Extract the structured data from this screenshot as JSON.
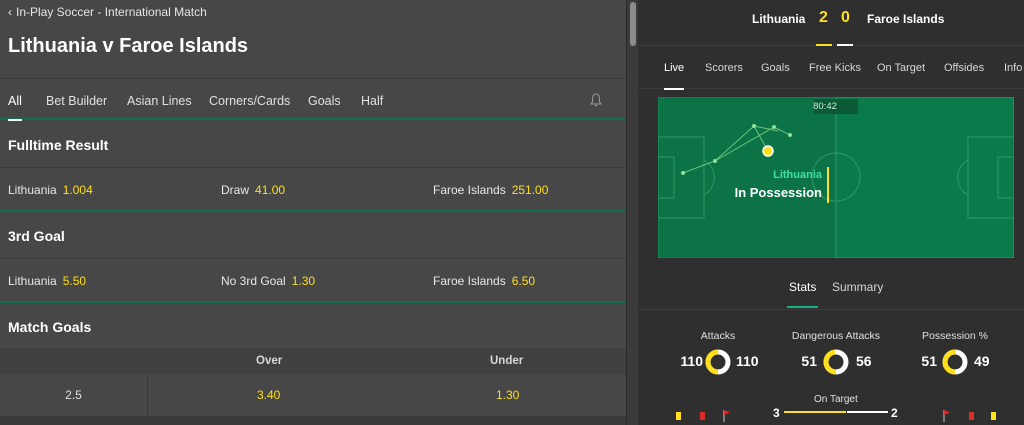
{
  "breadcrumb": "In-Play Soccer - International Match",
  "match_title": "Lithuania v Faroe Islands",
  "tabs": [
    "All",
    "Bet Builder",
    "Asian Lines",
    "Corners/Cards",
    "Goals",
    "Half"
  ],
  "markets": {
    "fulltime": {
      "title": "Fulltime Result",
      "selections": [
        {
          "name": "Lithuania",
          "odds": "1.004"
        },
        {
          "name": "Draw",
          "odds": "41.00"
        },
        {
          "name": "Faroe Islands",
          "odds": "251.00"
        }
      ]
    },
    "third_goal": {
      "title": "3rd Goal",
      "selections": [
        {
          "name": "Lithuania",
          "odds": "5.50"
        },
        {
          "name": "No 3rd Goal",
          "odds": "1.30"
        },
        {
          "name": "Faroe Islands",
          "odds": "6.50"
        }
      ]
    },
    "match_goals": {
      "title": "Match Goals",
      "col_over": "Over",
      "col_under": "Under",
      "line": "2.5",
      "over": "3.40",
      "under": "1.30"
    }
  },
  "scoreboard": {
    "home": "Lithuania",
    "away": "Faroe Islands",
    "home_score": "2",
    "away_score": "0"
  },
  "live_tabs": [
    "Live",
    "Scorers",
    "Goals",
    "Free Kicks",
    "On Target",
    "Offsides",
    "Info"
  ],
  "pitch": {
    "clock": "80:42",
    "team": "Lithuania",
    "status": "In Possession"
  },
  "stats_tabs": [
    "Stats",
    "Summary"
  ],
  "stats": [
    {
      "label": "Attacks",
      "home": "110",
      "away": "110",
      "home_share": 0.5
    },
    {
      "label": "Dangerous Attacks",
      "home": "51",
      "away": "56",
      "home_share": 0.48
    },
    {
      "label": "Possession %",
      "home": "51",
      "away": "49",
      "home_share": 0.51
    }
  ],
  "on_target": {
    "label": "On Target",
    "home": "3",
    "away": "2"
  },
  "colors": {
    "accent": "#ffdf1b",
    "green": "#126e51",
    "pitch": "#0b7a4a",
    "possession": "#14b38a"
  }
}
